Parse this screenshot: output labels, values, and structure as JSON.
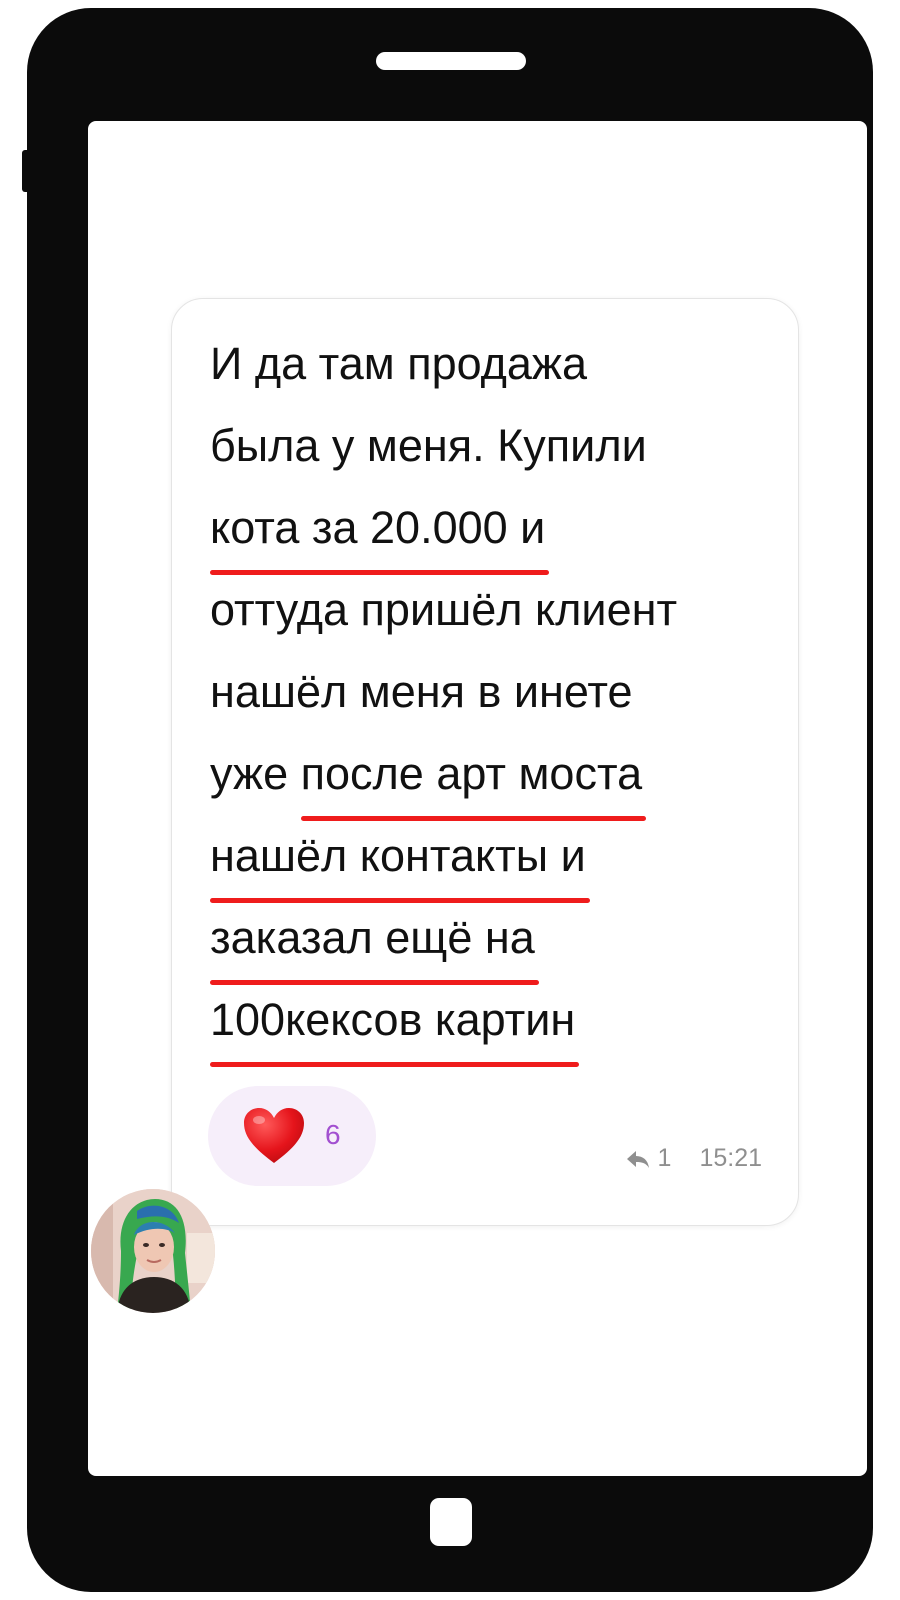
{
  "message": {
    "lines": [
      {
        "text": "И да там продажа",
        "underline": false
      },
      {
        "text": "была у меня. Купили",
        "underline": false
      },
      {
        "text": "кота за 20.000 и",
        "underline": true
      },
      {
        "text": "оттуда пришёл клиент",
        "underline": false
      },
      {
        "text": "нашёл меня в инете",
        "underline": false
      },
      {
        "prefix": "уже ",
        "text": "после арт моста",
        "underline": true
      },
      {
        "text": "нашёл контакты и",
        "underline": true
      },
      {
        "text": "заказал ещё на",
        "underline": true
      },
      {
        "text": "100кексов картин",
        "underline": true
      }
    ],
    "reaction": {
      "icon": "heart-icon",
      "count": "6"
    },
    "replies": {
      "icon": "reply-icon",
      "count": "1"
    },
    "time": "15:21"
  },
  "sender": {
    "avatar": "avatar-photo"
  },
  "colors": {
    "underline": "#ef1c1c",
    "heart": "#e5141b",
    "reaction_bg": "#f6eefa",
    "reaction_count": "#a24fd0",
    "meta": "#8f8f8f"
  }
}
